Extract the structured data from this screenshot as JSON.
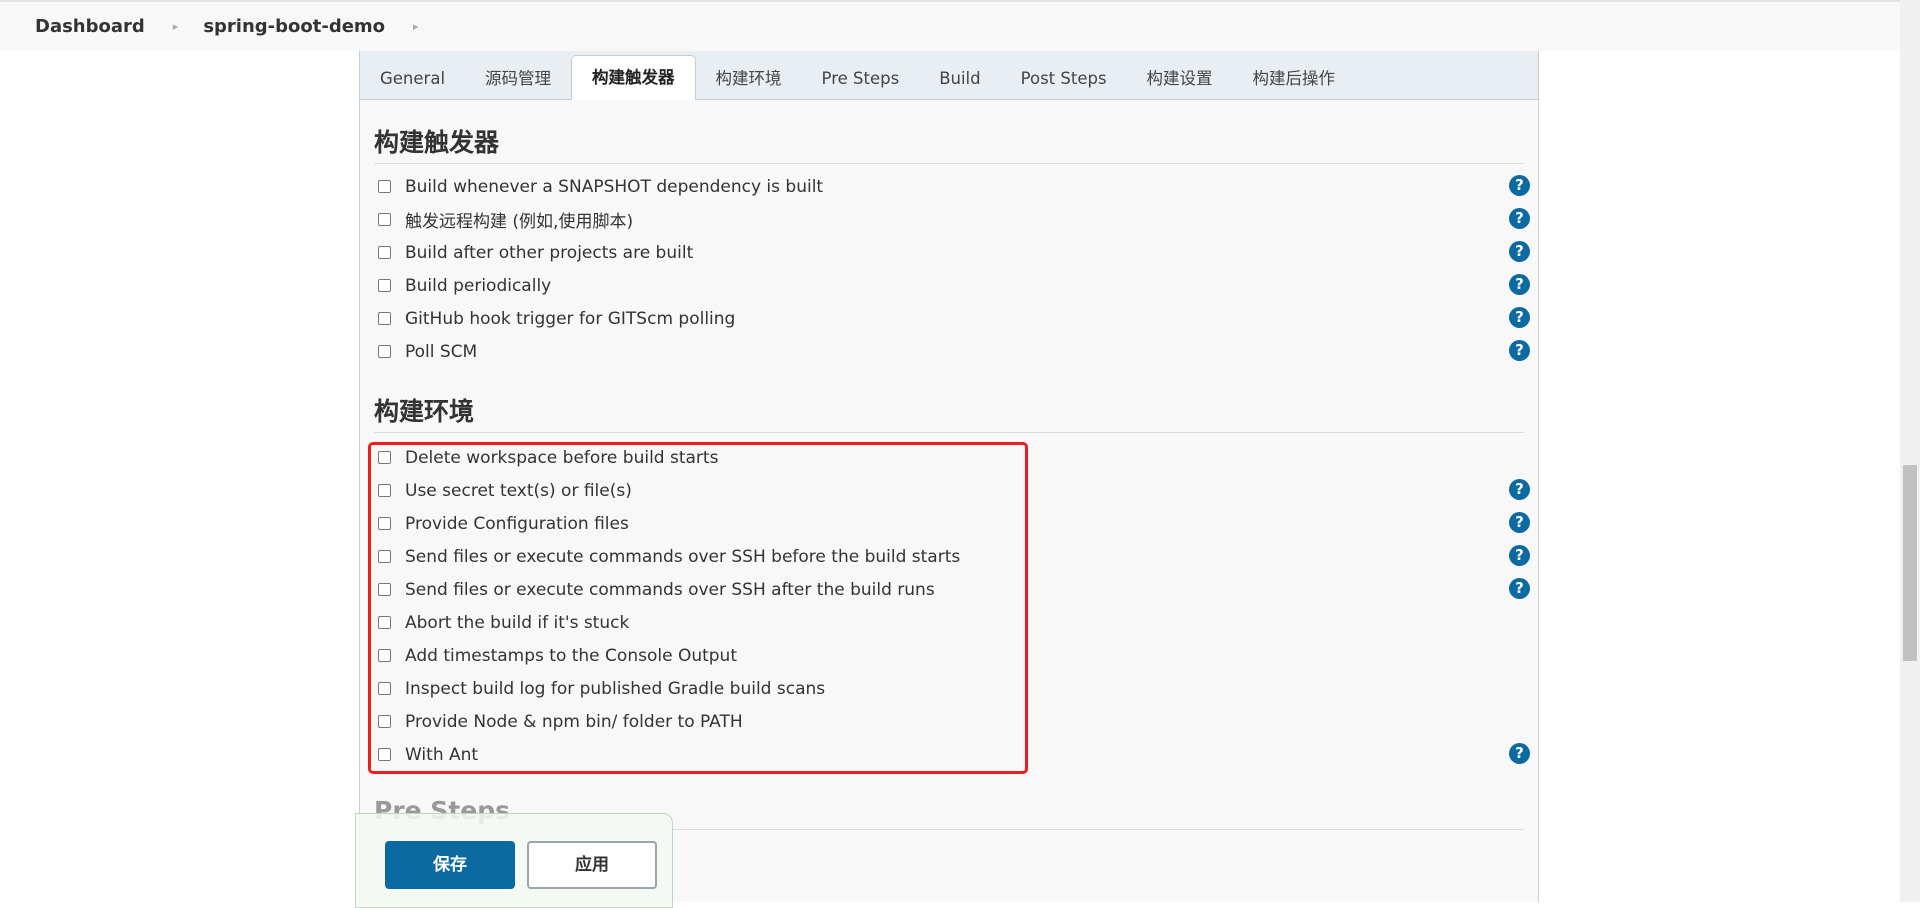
{
  "breadcrumb": [
    "Dashboard",
    "spring-boot-demo"
  ],
  "tabs": [
    {
      "label": "General",
      "active": false
    },
    {
      "label": "源码管理",
      "active": false
    },
    {
      "label": "构建触发器",
      "active": true
    },
    {
      "label": "构建环境",
      "active": false
    },
    {
      "label": "Pre Steps",
      "active": false
    },
    {
      "label": "Build",
      "active": false
    },
    {
      "label": "Post Steps",
      "active": false
    },
    {
      "label": "构建设置",
      "active": false
    },
    {
      "label": "构建后操作",
      "active": false
    }
  ],
  "triggers": {
    "title": "构建触发器",
    "items": [
      {
        "label": "Build whenever a SNAPSHOT dependency is built",
        "checked": false,
        "help": true
      },
      {
        "label": "触发远程构建 (例如,使用脚本)",
        "checked": false,
        "help": true
      },
      {
        "label": "Build after other projects are built",
        "checked": false,
        "help": true
      },
      {
        "label": "Build periodically",
        "checked": false,
        "help": true
      },
      {
        "label": "GitHub hook trigger for GITScm polling",
        "checked": false,
        "help": true
      },
      {
        "label": "Poll SCM",
        "checked": false,
        "help": true
      }
    ]
  },
  "environment": {
    "title": "构建环境",
    "highlight_color": "#f01c1c",
    "items": [
      {
        "label": "Delete workspace before build starts",
        "checked": false,
        "help": false
      },
      {
        "label": "Use secret text(s) or file(s)",
        "checked": false,
        "help": true
      },
      {
        "label": "Provide Configuration files",
        "checked": false,
        "help": true
      },
      {
        "label": "Send files or execute commands over SSH before the build starts",
        "checked": false,
        "help": true
      },
      {
        "label": "Send files or execute commands over SSH after the build runs",
        "checked": false,
        "help": true
      },
      {
        "label": "Abort the build if it's stuck",
        "checked": false,
        "help": false
      },
      {
        "label": "Add timestamps to the Console Output",
        "checked": false,
        "help": false
      },
      {
        "label": "Inspect build log for published Gradle build scans",
        "checked": false,
        "help": false
      },
      {
        "label": "Provide Node & npm bin/ folder to PATH",
        "checked": false,
        "help": false
      },
      {
        "label": "With Ant",
        "checked": false,
        "help": true
      }
    ]
  },
  "presteps": {
    "title": "Pre Steps"
  },
  "buttons": {
    "save": "保存",
    "apply": "应用"
  },
  "help_icon": "question-circle-icon",
  "accent": "#0b6aa2"
}
